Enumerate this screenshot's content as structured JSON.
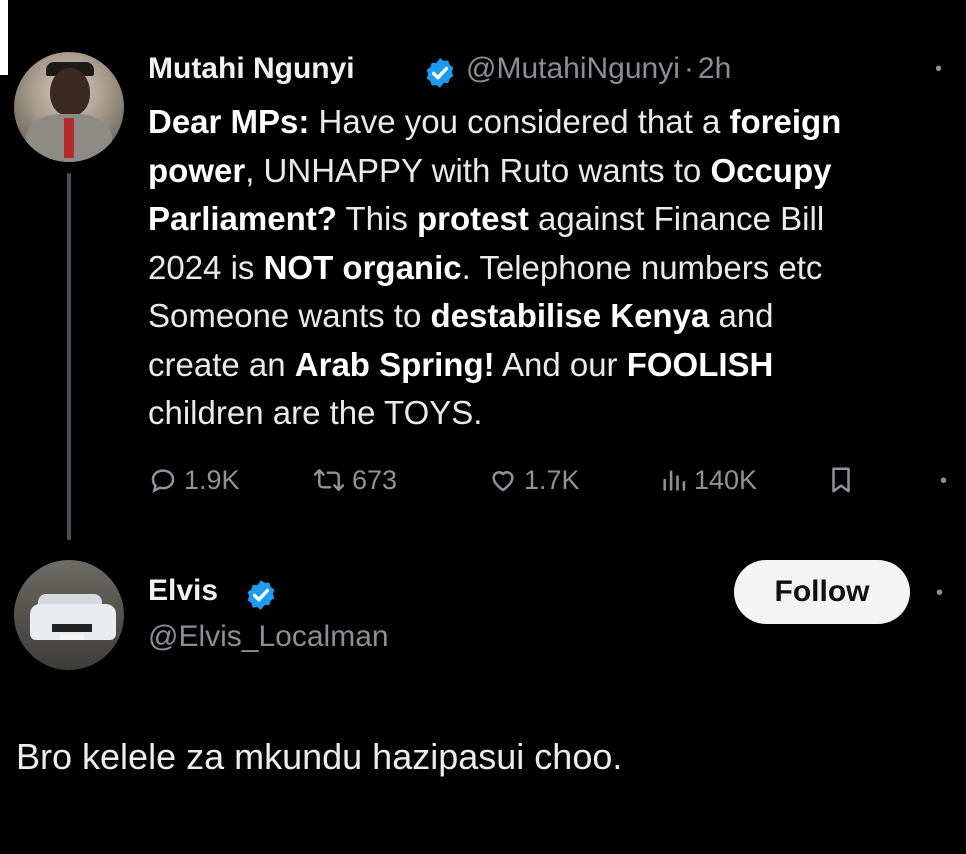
{
  "original_tweet": {
    "author_name": "Mutahi Ngunyi",
    "author_handle": "@MutahiNgunyi",
    "separator": "·",
    "time": "2h",
    "verified": true,
    "body_lines": [
      [
        {
          "t": "Dear MPs:",
          "b": true
        },
        {
          "t": " Have you considered that a ",
          "b": false
        },
        {
          "t": "foreign",
          "b": true
        }
      ],
      [
        {
          "t": "power",
          "b": true
        },
        {
          "t": ", UNHAPPY with Ruto wants to ",
          "b": false
        },
        {
          "t": "Occupy",
          "b": true
        }
      ],
      [
        {
          "t": "Parliament?",
          "b": true
        },
        {
          "t": " This ",
          "b": false
        },
        {
          "t": "protest",
          "b": true
        },
        {
          "t": " against Finance Bill",
          "b": false
        }
      ],
      [
        {
          "t": "2024 is ",
          "b": false
        },
        {
          "t": "NOT organic",
          "b": true
        },
        {
          "t": ". Telephone numbers etc",
          "b": false
        }
      ],
      [
        {
          "t": "Someone wants to ",
          "b": false
        },
        {
          "t": "destabilise Kenya",
          "b": true
        },
        {
          "t": " and",
          "b": false
        }
      ],
      [
        {
          "t": "create an ",
          "b": false
        },
        {
          "t": "Arab Spring!",
          "b": true
        },
        {
          "t": " And our ",
          "b": false
        },
        {
          "t": "FOOLISH",
          "b": true
        }
      ],
      [
        {
          "t": "children are the TOYS.",
          "b": false
        }
      ]
    ],
    "stats": {
      "replies": "1.9K",
      "reposts": "673",
      "likes": "1.7K",
      "views": "140K"
    },
    "icons": [
      "reply-icon",
      "repost-icon",
      "like-icon",
      "views-icon",
      "bookmark-icon",
      "verified-badge-icon"
    ]
  },
  "reply_tweet": {
    "author_name": "Elvis",
    "author_handle": "@Elvis_Localman",
    "verified": true,
    "follow_label": "Follow",
    "body": "Bro kelele za mkundu hazipasui choo."
  },
  "colors": {
    "background": "#000000",
    "text": "#e7e9ea",
    "muted": "#8b8f95",
    "verified_blue": "#1d9bf0",
    "follow_bg": "#f4f4f4",
    "thread_line": "#4a4d52"
  }
}
